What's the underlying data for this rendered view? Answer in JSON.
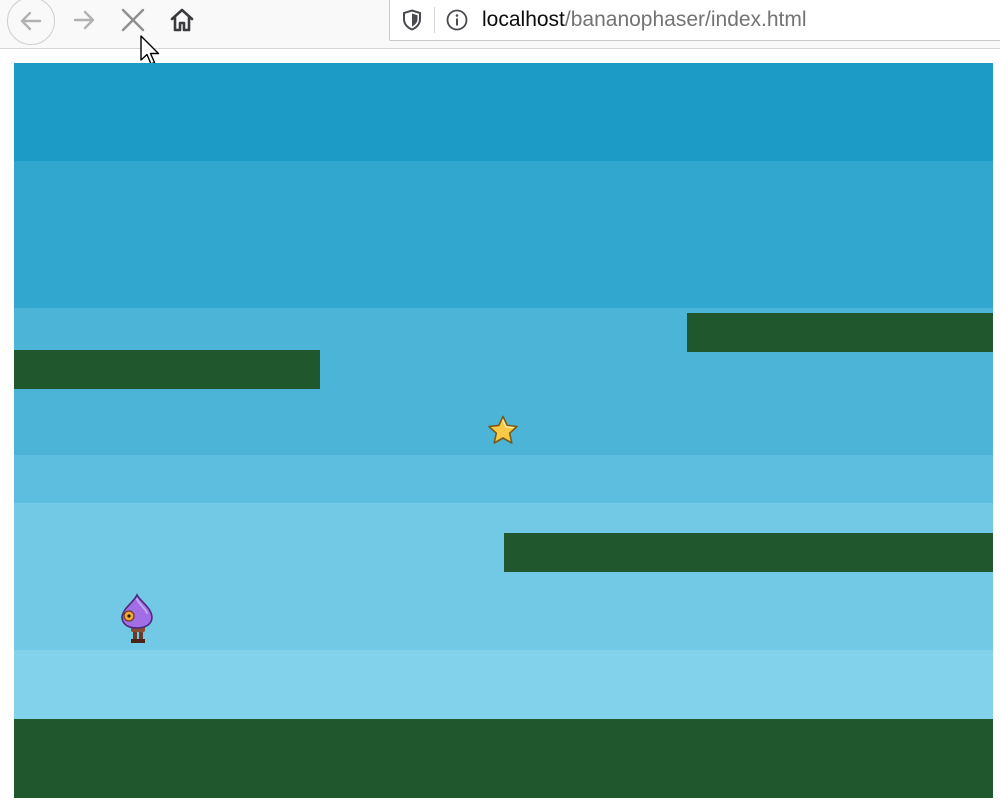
{
  "browser": {
    "url_host": "localhost",
    "url_path": "/bananophaser/index.html",
    "icons": {
      "back": "back-arrow-icon",
      "forward": "forward-arrow-icon",
      "stop": "close-icon",
      "home": "home-icon",
      "shield": "shield-icon",
      "info": "info-icon"
    }
  },
  "game": {
    "colors": {
      "sky_bands": [
        "#1c9bc7",
        "#31a7cf",
        "#4cb4d7",
        "#5dbee0",
        "#72c9e5",
        "#83d2ec"
      ],
      "platform": "#20572d",
      "star": "#f7c948",
      "player": "#a16ee6"
    },
    "entities": [
      "ground",
      "platform",
      "platform",
      "platform",
      "star",
      "player"
    ]
  }
}
